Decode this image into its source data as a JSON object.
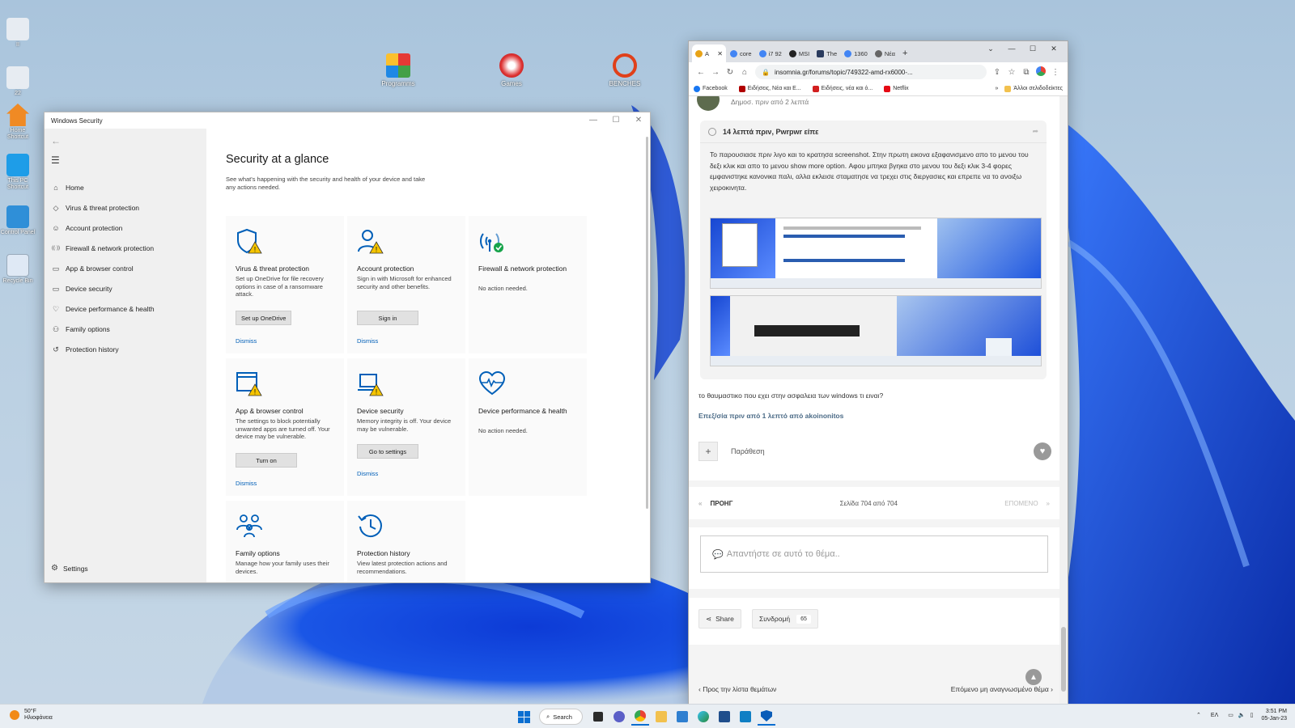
{
  "colors": {
    "accent": "#005fb8",
    "warning": "#f5c400",
    "ok": "#16a34a",
    "wallpaper_blue": "#1a4fd0"
  },
  "desktop": {
    "icons_left": [
      {
        "label": "ΙΙ",
        "icon": "pc-icon"
      },
      {
        "label": "22",
        "icon": "pc-icon"
      },
      {
        "label": "Home Shortcut",
        "icon": "home-icon"
      },
      {
        "label": "This PC Shortcut",
        "icon": "monitor-icon"
      },
      {
        "label": "Control Panel",
        "icon": "control-panel-icon"
      },
      {
        "label": "Recycle Bin",
        "icon": "recycle-bin-icon"
      }
    ],
    "icons_top": [
      {
        "label": "Programms",
        "icon": "programs-icon"
      },
      {
        "label": "Games",
        "icon": "games-icon"
      },
      {
        "label": "BENCHES",
        "icon": "no-entry-icon"
      }
    ]
  },
  "winsec": {
    "title": "Windows Security",
    "back": "←",
    "menu": "☰",
    "nav": [
      {
        "label": "Home",
        "icon": "home-icon",
        "glyph": "⌂"
      },
      {
        "label": "Virus & threat protection",
        "icon": "shield-icon",
        "glyph": "◇"
      },
      {
        "label": "Account protection",
        "icon": "person-icon",
        "glyph": "☺"
      },
      {
        "label": "Firewall & network protection",
        "icon": "wifi-icon",
        "glyph": "((·))"
      },
      {
        "label": "App & browser control",
        "icon": "app-window-icon",
        "glyph": "▭"
      },
      {
        "label": "Device security",
        "icon": "laptop-icon",
        "glyph": "▭"
      },
      {
        "label": "Device performance & health",
        "icon": "heart-icon",
        "glyph": "♡"
      },
      {
        "label": "Family options",
        "icon": "family-icon",
        "glyph": "⚇"
      },
      {
        "label": "Protection history",
        "icon": "history-icon",
        "glyph": "↺"
      }
    ],
    "settings": "Settings",
    "settings_glyph": "⚙",
    "heading": "Security at a glance",
    "subheading": "See what's happening with the security and health of your device and take any actions needed.",
    "cards": [
      {
        "title": "Virus & threat protection",
        "desc": "Set up OneDrive for file recovery options in case of a ransomware attack.",
        "button": "Set up OneDrive",
        "dismiss": "Dismiss",
        "icon": "shield-warning-icon"
      },
      {
        "title": "Account protection",
        "desc": "Sign in with Microsoft for enhanced security and other benefits.",
        "button": "Sign in",
        "dismiss": "Dismiss",
        "icon": "person-warning-icon"
      },
      {
        "title": "Firewall & network protection",
        "desc": "No action needed.",
        "button": "",
        "dismiss": "",
        "icon": "wifi-check-icon"
      },
      {
        "title": "App & browser control",
        "desc": "The settings to block potentially unwanted apps are turned off. Your device may be vulnerable.",
        "button": "Turn on",
        "dismiss": "Dismiss",
        "icon": "app-warning-icon"
      },
      {
        "title": "Device security",
        "desc": "Memory integrity is off. Your device may be vulnerable.",
        "button": "Go to settings",
        "dismiss": "Dismiss",
        "icon": "laptop-warning-icon"
      },
      {
        "title": "Device performance & health",
        "desc": "No action needed.",
        "button": "",
        "dismiss": "",
        "icon": "heart-pulse-icon"
      },
      {
        "title": "Family options",
        "desc": "Manage how your family uses their devices.",
        "button": "",
        "dismiss": "",
        "icon": "family-icon"
      },
      {
        "title": "Protection history",
        "desc": "View latest protection actions and recommendations.",
        "button": "",
        "dismiss": "",
        "icon": "history-icon"
      }
    ]
  },
  "chrome": {
    "tabs": [
      {
        "label": "A",
        "color": "#e8a317"
      },
      {
        "label": "core",
        "color": "#4285f4"
      },
      {
        "label": "i7 92",
        "color": "#4285f4"
      },
      {
        "label": "MSI",
        "color": "#222222"
      },
      {
        "label": "The",
        "color": "#2a3b5e"
      },
      {
        "label": "1360",
        "color": "#4285f4"
      },
      {
        "label": "Νέα",
        "color": "#666666"
      }
    ],
    "tab_close": "✕",
    "new_tab": "+",
    "win_controls": [
      "⌄",
      "—",
      "☐",
      "✕"
    ],
    "url": "insomnia.gr/forums/topic/749322-amd-rx6000-...",
    "bookmarks": [
      {
        "label": "Facebook",
        "color": "#1877f2"
      },
      {
        "label": "Ειδήσεις, Νέα και Ε...",
        "color": "#b00000"
      },
      {
        "label": "Ειδήσεις, νέα και ό...",
        "color": "#d21f1f"
      },
      {
        "label": "Netflix",
        "color": "#e50914"
      }
    ],
    "bookmarks_more": "»",
    "other_bookmarks": "Άλλοι σελιδοδείκτες",
    "post_meta": "Δημοσ. πριν από 2 λεπτά",
    "quote_header": "14 λεπτά πριν, Pwrpwr είπε",
    "quote_text": "Το παρουσιασε  πριν λιγο και το κρατησα screenshot. Στην πρωτη εικονα εξαφανισμενο απο το μενου του δεξι κλικ και απο το μενου show more option. Αφου μπηκα βγηκα στο μενου του δεξι κλικ 3-4 φορες εμφανιστηκε κανονικα παλι, αλλα εκλεισε σταματησε να τρεχει στις διεργασιες και επρεπε να το ανοιξω χειροκινητα.",
    "reply_text": "το θαυμαστικο που εχει στην ασφαλεια των windows τι ειναι?",
    "edited_text": "Επεξ/σία πριν από 1 λεπτό από akoinonitos",
    "quote_button": "Παράθεση",
    "prev": "ΠΡΟΗΓ",
    "page_info": "Σελίδα 704 από 704",
    "next": "ΕΠΟΜΕΝΟ",
    "reply_placeholder": "Απαντήστε σε αυτό το θέμα..",
    "share": "Share",
    "subscribe": "Συνδρομή",
    "subscribe_count": "65",
    "back_to_list": "Προς την λίστα θεμάτων",
    "next_unread": "Επόμενο μη αναγνωσμένο θέμα"
  },
  "taskbar": {
    "temp": "50°F",
    "weather": "Ηλιοφάνεια",
    "search": "Search",
    "lang": "ΕΛ",
    "time": "3:51 PM",
    "date": "05-Jan-23"
  }
}
